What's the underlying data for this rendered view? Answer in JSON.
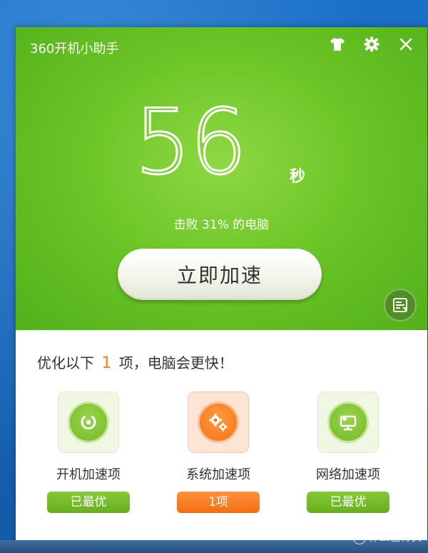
{
  "app": {
    "title": "360开机小助手"
  },
  "header_icons": {
    "skin": "tshirt-icon",
    "settings": "gear-icon",
    "close": "close-icon"
  },
  "boot": {
    "time_value": "56",
    "time_unit": "秒",
    "beat_text": "击败 31% 的电脑",
    "accelerate_label": "立即加速",
    "report_icon": "report-icon"
  },
  "summary": {
    "prefix": "优化以下",
    "count": "1",
    "suffix": "项，电脑会更快！"
  },
  "categories": [
    {
      "label": "开机加速项",
      "status": "已最优",
      "icon": "power-icon",
      "color": "#74bb27"
    },
    {
      "label": "系统加速项",
      "status": "1项",
      "icon": "gears-icon",
      "color": "#f47417"
    },
    {
      "label": "网络加速项",
      "status": "已最优",
      "icon": "network-monitor-icon",
      "color": "#74bb27"
    }
  ],
  "colors": {
    "brand_green": "#6dc628",
    "accent_orange": "#f57c1f"
  },
  "watermark": {
    "badge": "值",
    "text": "什么值得买"
  }
}
